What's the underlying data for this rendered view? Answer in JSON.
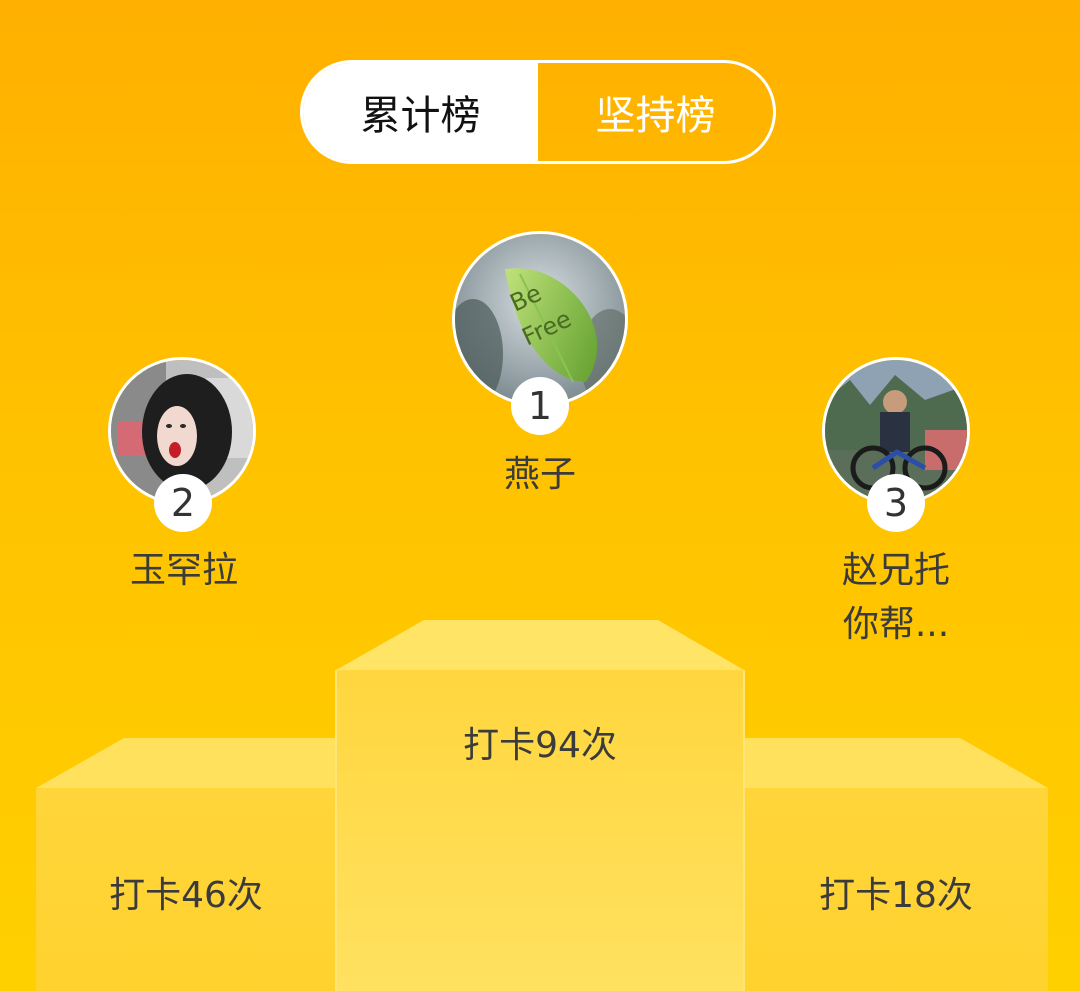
{
  "tabs": {
    "cumulative": "累计榜",
    "persistence": "坚持榜"
  },
  "leaders": {
    "first": {
      "rank": "1",
      "name": "燕子",
      "checkins": "打卡94次",
      "avatar_text_1": "Be",
      "avatar_text_2": "Free"
    },
    "second": {
      "rank": "2",
      "name": "玉罕拉",
      "checkins": "打卡46次"
    },
    "third": {
      "rank": "3",
      "name_line1": "赵兄托",
      "name_line2": "你帮...",
      "checkins": "打卡18次"
    }
  },
  "colors": {
    "background_top": "#FFB000",
    "background_bottom": "#FFD000",
    "podium_top": "#FFE15E",
    "podium_front": "#FFD83A"
  }
}
